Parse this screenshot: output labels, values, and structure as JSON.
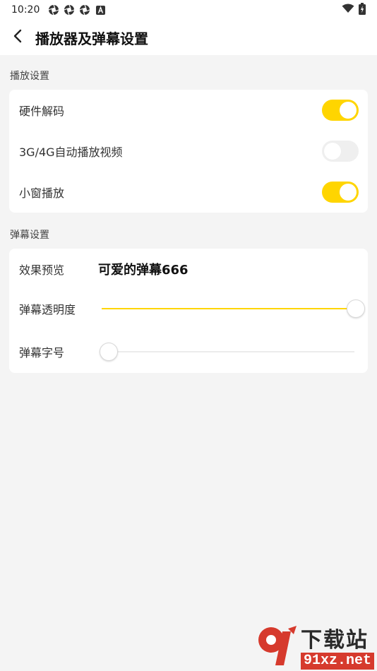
{
  "status_bar": {
    "time": "10:20",
    "left_icons": [
      "aperture-icon",
      "aperture-icon",
      "aperture-icon",
      "a-badge-icon"
    ],
    "right_icons": [
      "wifi-icon",
      "battery-icon"
    ]
  },
  "header": {
    "title": "播放器及弹幕设置",
    "back_icon": "chevron-left-icon"
  },
  "playback": {
    "section_label": "播放设置",
    "items": [
      {
        "label": "硬件解码",
        "enabled": true
      },
      {
        "label": "3G/4G自动播放视频",
        "enabled": false
      },
      {
        "label": "小窗播放",
        "enabled": true
      }
    ]
  },
  "danmaku": {
    "section_label": "弹幕设置",
    "preview_label": "效果预览",
    "preview_text": "可爱的弹幕666",
    "opacity_label": "弹幕透明度",
    "opacity_value": 1.0,
    "size_label": "弹幕字号",
    "size_value": 0.0
  },
  "colors": {
    "accent": "#ffd500",
    "toggle_off": "#efefef",
    "background": "#f4f4f4"
  },
  "watermark": {
    "brand": "下载站",
    "url": "91xz.net"
  }
}
